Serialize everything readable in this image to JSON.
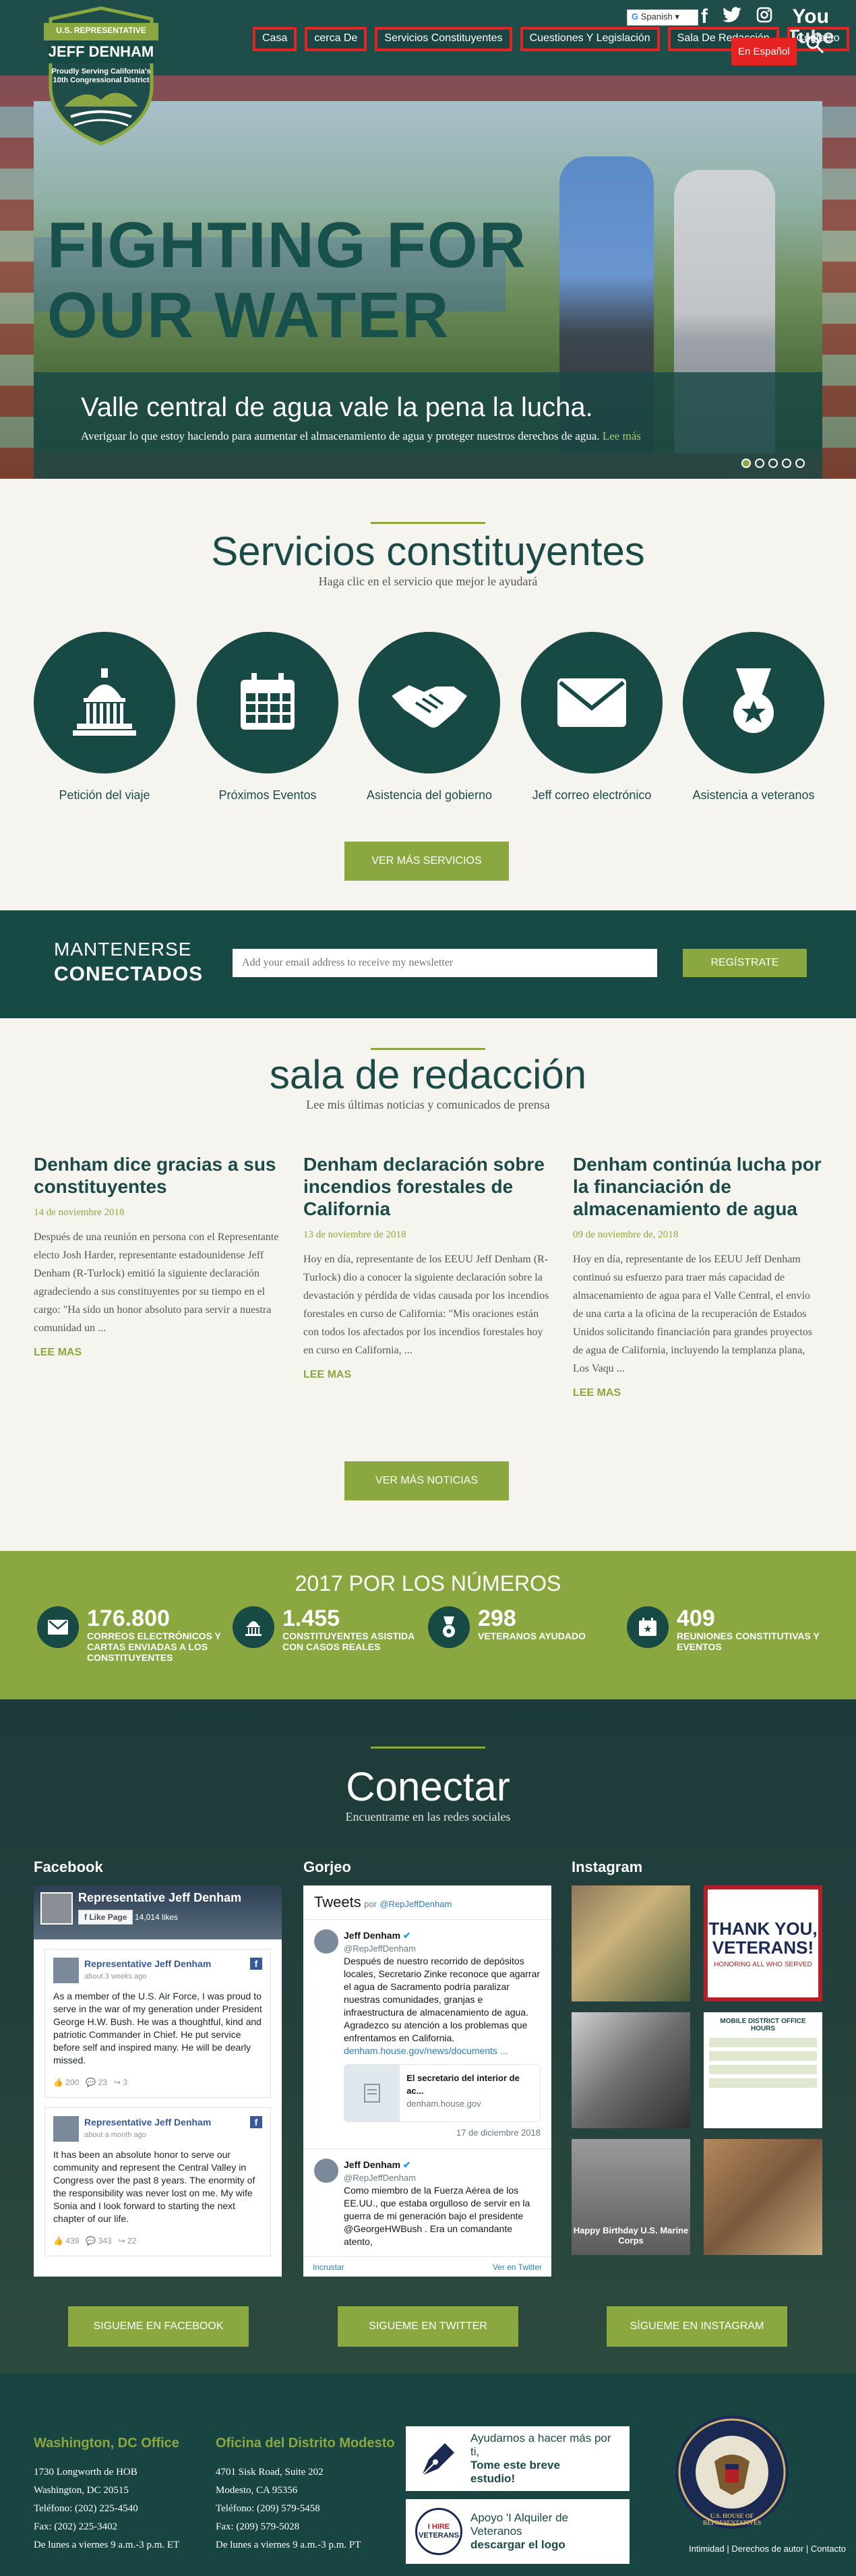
{
  "header": {
    "logo": {
      "line1": "U.S. REPRESENTATIVE",
      "name": "JEFF DENHAM",
      "tagline": "Proudly Serving California's 10th Congressional District"
    },
    "nav": [
      "Casa",
      "cerca De",
      "Servicios Constituyentes",
      "Cuestiones Y Legislación",
      "Sala De Redacción",
      "Contacto"
    ],
    "espanol": "En Español",
    "language_select": "Spanish",
    "social": [
      "f",
      "twitter",
      "instagram",
      "YouTube"
    ],
    "youtube_label_1": "You",
    "youtube_label_2": "Tube",
    "icon_names": [
      "facebook-icon",
      "twitter-icon",
      "instagram-icon",
      "youtube-icon",
      "search-icon"
    ]
  },
  "hero": {
    "title_line1": "FIGHTING FOR",
    "title_line2": "OUR WATER",
    "caption_title": "Valle central de agua vale la pena la lucha.",
    "caption_text": "Averiguar lo que estoy haciendo para aumentar el almacenamiento de agua y proteger nuestros derechos de agua.",
    "read_more": "Lee más",
    "slides": 5,
    "active_slide": 1
  },
  "services": {
    "title": "Servicios constituyentes",
    "subtitle": "Haga clic en el servicio que mejor le ayudará",
    "items": [
      {
        "label": "Petición del viaje",
        "icon": "capitol-icon"
      },
      {
        "label": "Próximos Eventos",
        "icon": "calendar-icon"
      },
      {
        "label": "Asistencia del gobierno",
        "icon": "handshake-icon"
      },
      {
        "label": "Jeff correo electrónico",
        "icon": "envelope-icon"
      },
      {
        "label": "Asistencia a veteranos",
        "icon": "medal-icon"
      }
    ],
    "more_button": "VER MÁS SERVICIOS"
  },
  "stay_connected": {
    "line1": "MANTENERSE",
    "line2": "CONECTADOS",
    "email_placeholder": "Add your email address to receive my newsletter",
    "button": "REGÍSTRATE"
  },
  "newsroom": {
    "title": "sala de redacción",
    "subtitle": "Lee mis últimas noticias y comunicados de prensa",
    "articles": [
      {
        "title": "Denham dice gracias a sus constituyentes",
        "date": "14 de noviembre 2018",
        "body": "Después de una reunión en persona con el Representante electo Josh Harder, representante estadounidense Jeff Denham (R-Turlock) emitió la siguiente declaración agradeciendo a sus constituyentes por su tiempo en el cargo: \"Ha sido un honor absoluto para servir a nuestra comunidad un ...",
        "more": "LEE MAS"
      },
      {
        "title": "Denham declaración sobre incendios forestales de California",
        "date": "13 de noviembre de 2018",
        "body": "Hoy en día, representante de los EEUU Jeff Denham (R-Turlock) dio a conocer la siguiente declaración sobre la devastación y pérdida de vidas causada por los incendios forestales en curso de California: \"Mis oraciones están con todos los afectados por los incendios forestales hoy en curso en California, ...",
        "more": "LEE MAS"
      },
      {
        "title": "Denham continúa lucha por la financiación de almacenamiento de agua",
        "date": "09 de noviembre de, 2018",
        "body": "Hoy en día, representante de los EEUU Jeff Denham continuó su esfuerzo para traer más capacidad de almacenamiento de agua para el Valle Central, el envío de una carta a la oficina de la recuperación de Estados Unidos solicitando financiación para grandes proyectos de agua de California, incluyendo la templanza plana, Los Vaqu ...",
        "more": "LEE MAS"
      }
    ],
    "more_button": "VER MÁS NOTICIAS"
  },
  "numbers": {
    "title": "2017 POR LOS NÚMEROS",
    "stats": [
      {
        "value": "176.800",
        "label": "CORREOS ELECTRÓNICOS Y CARTAS ENVIADAS A LOS CONSTITUYENTES",
        "icon": "envelope-icon"
      },
      {
        "value": "1.455",
        "label": "CONSTITUYENTES ASISTIDA CON CASOS REALES",
        "icon": "capitol-icon"
      },
      {
        "value": "298",
        "label": "VETERANOS AYUDADO",
        "icon": "medal-icon"
      },
      {
        "value": "409",
        "label": "REUNIONES CONSTITUTIVAS Y EVENTOS",
        "icon": "calendar-icon"
      }
    ]
  },
  "connect": {
    "title": "Conectar",
    "subtitle": "Encuentrame en las redes sociales",
    "facebook": {
      "heading": "Facebook",
      "page_name": "Representative Jeff Denham",
      "like_button": "Like Page",
      "followers": "14,014 likes",
      "posts": [
        {
          "author": "Representative Jeff Denham",
          "time": "about 3 weeks ago",
          "text": "As a member of the U.S. Air Force, I was proud to serve in the war of my generation under President George H.W. Bush. He was a thoughtful, kind and patriotic Commander in Chief. He put service before self and inspired many. He will be dearly missed.",
          "likes": "200",
          "comments": "23",
          "shares": "3"
        },
        {
          "author": "Representative Jeff Denham",
          "time": "about a month ago",
          "text": "It has been an absolute honor to serve our community and represent the Central Valley in Congress over the past 8 years. The enormity of the responsibility was never lost on me. My wife Sonia and I look forward to starting the next chapter of our life.",
          "likes": "439",
          "comments": "343",
          "shares": "22"
        }
      ]
    },
    "twitter": {
      "heading": "Gorjeo",
      "widget_title": "Tweets",
      "by": "por",
      "handle": "@RepJeffDenham",
      "tweets": [
        {
          "author": "Jeff Denham",
          "handle": "@RepJeffDenham",
          "text": "Después de nuestro recorrido de depósitos locales, Secretario Zinke reconoce que agarrar el agua de Sacramento podría paralizar nuestras comunidades, granjas e infraestructura de almacenamiento de agua. Agradezco su atención a los problemas que enfrentamos en California.",
          "link": "denham.house.gov/news/documents ...",
          "card_title": "El secretario del interior de ac...",
          "card_url": "denham.house.gov",
          "date": "17 de diciembre 2018"
        },
        {
          "author": "Jeff Denham",
          "handle": "@RepJeffDenham",
          "text": "Como miembro de la Fuerza Aérea de los EE.UU., que estaba orgulloso de servir en la guerra de mi generación bajo el presidente @GeorgeHWBush . Era un comandante atento,",
          "link": "",
          "card_title": "",
          "card_url": "",
          "date": ""
        }
      ],
      "embed": "Incrustar",
      "view_on": "Ver en Twitter"
    },
    "instagram": {
      "heading": "Instagram",
      "posts": [
        "",
        "THANK YOU, VETERANS!",
        "",
        "MOBILE DISTRICT OFFICE HOURS",
        "Happy Birthday U.S. Marine Corps",
        ""
      ],
      "thank_sub": "HONORING ALL WHO SERVED"
    },
    "buttons": [
      "SIGUEME EN FACEBOOK",
      "SIGUEME EN TWITTER",
      "SÍGUEME EN INSTAGRAM"
    ]
  },
  "footer": {
    "dc": {
      "title": "Washington, DC Office",
      "lines": [
        "1730 Longworth de HOB",
        "Washington, DC 20515",
        "Teléfono: (202) 225-4540",
        "Fax: (202) 225-3402",
        "De lunes a viernes 9 a.m.-3 p.m. ET"
      ]
    },
    "modesto": {
      "title": "Oficina del Distrito Modesto",
      "lines": [
        "4701 Sisk Road, Suite 202",
        "Modesto, CA 95356",
        "Teléfono: (209) 579-5458",
        "Fax: (209) 579-5028",
        "De lunes a viernes 9 a.m.-3 p.m. PT"
      ]
    },
    "cta1": {
      "line1": "Ayudarnos a hacer más por ti,",
      "line2": "Tome este breve",
      "line3": "estudio!"
    },
    "cta2": {
      "line1": "Apoyo 'I Alquiler de",
      "line2": "Veteranos",
      "line3": "descargar el logo"
    },
    "cta2_badge_1": "I HIRE",
    "cta2_badge_2": "VETERANS",
    "seal_text": "U.S. HOUSE OF REPRESENTATIVES",
    "links": "Intimidad | Derechos de autor | Contacto"
  },
  "colors": {
    "brand_dark": "#174945",
    "brand_green": "#8aa83f",
    "nav_highlight": "#e52421"
  }
}
